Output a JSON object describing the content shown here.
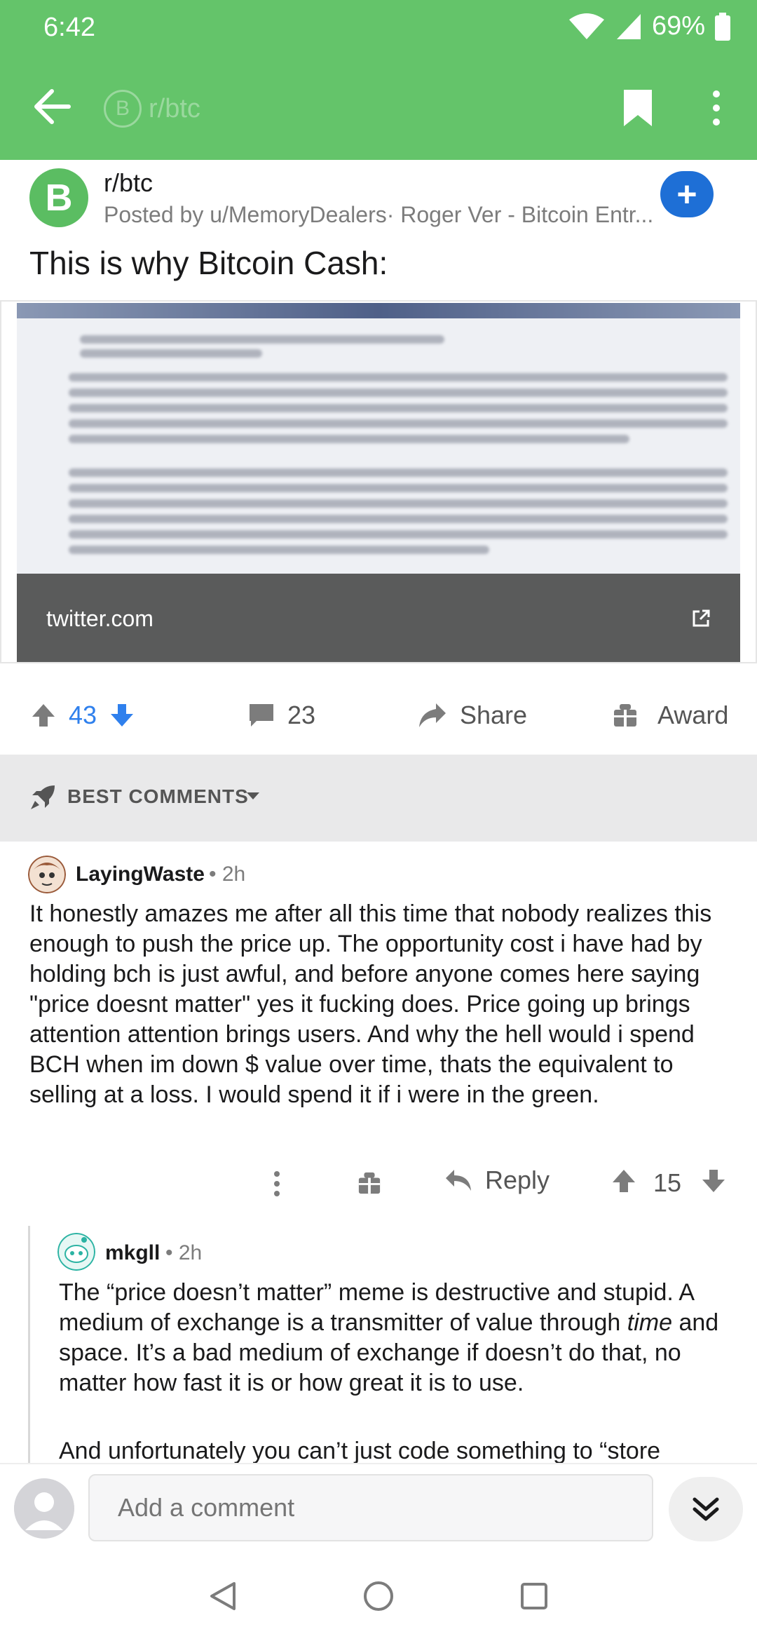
{
  "status_bar": {
    "time": "6:42",
    "battery": "69%"
  },
  "app_bar": {
    "subreddit": "r/btc",
    "subreddit_icon_letter": "B"
  },
  "post": {
    "subreddit": "r/btc",
    "subreddit_avatar_letter": "B",
    "posted_by": "Posted by u/MemoryDealers· Roger Ver - Bitcoin Entr...",
    "title": "This is why Bitcoin Cash:",
    "link_domain": "twitter.com",
    "votes": "43",
    "comments_count": "23",
    "share_label": "Share",
    "award_label": "Award"
  },
  "sort": {
    "label": "BEST COMMENTS"
  },
  "comments": [
    {
      "user": "LayingWaste",
      "time": "• 2h",
      "body": "It honestly amazes me after all this time that nobody realizes this enough to push the price up. The opportunity cost i have had by holding bch is just awful, and before anyone comes here saying \"price doesnt matter\" yes it fucking does. Price going up brings attention attention brings users. And why the hell would i spend BCH when im down $ value over time, thats the equivalent to selling at a loss. I would spend it if i were in the green.",
      "reply_label": "Reply",
      "votes": "15"
    },
    {
      "user": "mkgll",
      "time": "• 2h",
      "body_part1": "The “price doesn’t matter” meme is destructive and stupid. A medium of exchange is a transmitter of value through ",
      "body_em": "time",
      "body_part2": " and space. It’s a bad medium of exchange if doesn’t do that, no matter how fast it is or how great it is to use.",
      "body_p2": "And unfortunately you can’t just code something to “store"
    }
  ],
  "comment_bar": {
    "placeholder": "Add a comment"
  },
  "colors": {
    "accent_green": "#64c46a",
    "upvote_blue": "#2f80ed",
    "join_blue": "#1e6fd6"
  }
}
